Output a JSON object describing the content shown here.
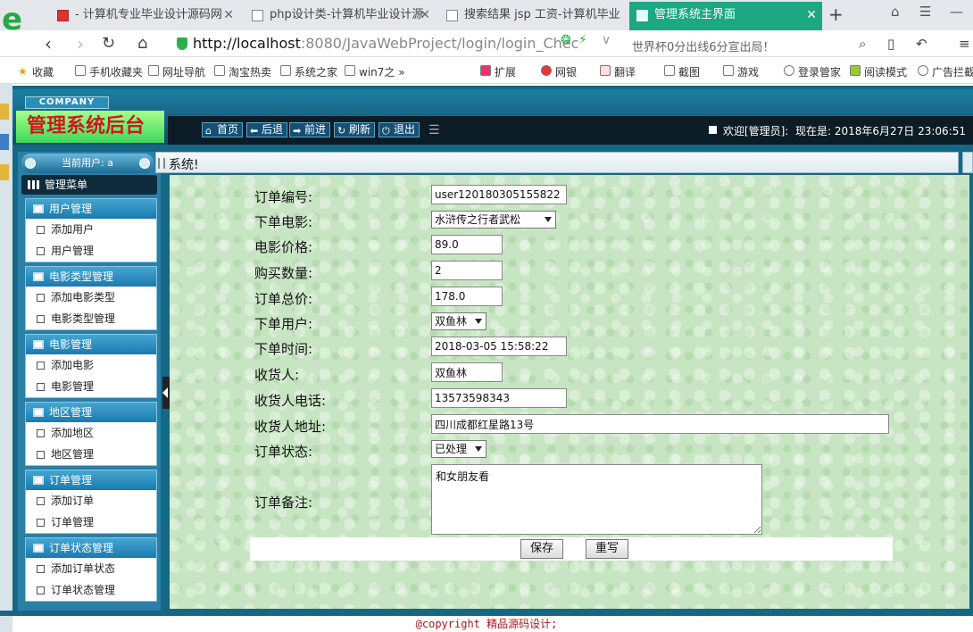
{
  "browser": {
    "tabs": [
      {
        "label": "- 计算机专业毕业设计源码网",
        "active": false
      },
      {
        "label": "php设计类-计算机毕业设计源",
        "active": false
      },
      {
        "label": "搜索结果 jsp 工资-计算机毕业",
        "active": false
      },
      {
        "label": "管理系统主界面",
        "active": true
      }
    ],
    "new_tab_label": "+",
    "url_host": "http://localhost",
    "url_rest": ":8080/JavaWebProject/login/login_Chec",
    "search_hint": "世界杯0分出线6分宣出局！",
    "bookmarks": [
      "收藏",
      "手机收藏夹",
      "网址导航",
      "淘宝热卖",
      "系统之家",
      "win7之",
      "扩展",
      "网银",
      "翻译",
      "截图",
      "游戏",
      "登录管家",
      "阅读模式",
      "广告拦截"
    ]
  },
  "header": {
    "company": "COMPANY",
    "title": "管理系统后台",
    "nav": [
      "首页",
      "后退",
      "前进",
      "刷新",
      "退出"
    ],
    "welcome": "欢迎[管理员]:",
    "now_label": "现在是:",
    "datetime": "2018年6月27日 23:06:51"
  },
  "sidebar": {
    "current_user": "当前用户: a",
    "main_menu": "管理菜单",
    "groups": [
      {
        "title": "用户管理",
        "items": [
          "添加用户",
          "用户管理"
        ]
      },
      {
        "title": "电影类型管理",
        "items": [
          "添加电影类型",
          "电影类型管理"
        ]
      },
      {
        "title": "电影管理",
        "items": [
          "添加电影",
          "电影管理"
        ]
      },
      {
        "title": "地区管理",
        "items": [
          "添加地区",
          "地区管理"
        ]
      },
      {
        "title": "订单管理",
        "items": [
          "添加订单",
          "订单管理"
        ]
      },
      {
        "title": "订单状态管理",
        "items": [
          "添加订单状态",
          "订单状态管理"
        ]
      }
    ]
  },
  "breadcrumb": "系统!",
  "form": {
    "order_no_label": "订单编号:",
    "order_no": "user120180305155822",
    "movie_label": "下单电影:",
    "movie": "水浒传之行者武松",
    "price_label": "电影价格:",
    "price": "89.0",
    "qty_label": "购买数量:",
    "qty": "2",
    "total_label": "订单总价:",
    "total": "178.0",
    "user_label": "下单用户:",
    "user": "双鱼林",
    "time_label": "下单时间:",
    "time": "2018-03-05 15:58:22",
    "receiver_label": "收货人:",
    "receiver": "双鱼林",
    "phone_label": "收货人电话:",
    "phone": "13573598343",
    "address_label": "收货人地址:",
    "address": "四川成都红星路13号",
    "status_label": "订单状态:",
    "status": "已处理",
    "remark_label": "订单备注:",
    "remark": "和女朋友看",
    "save_label": "保存",
    "reset_label": "重写"
  },
  "footer": {
    "copyright": "@copyright 精品源码设计;"
  }
}
